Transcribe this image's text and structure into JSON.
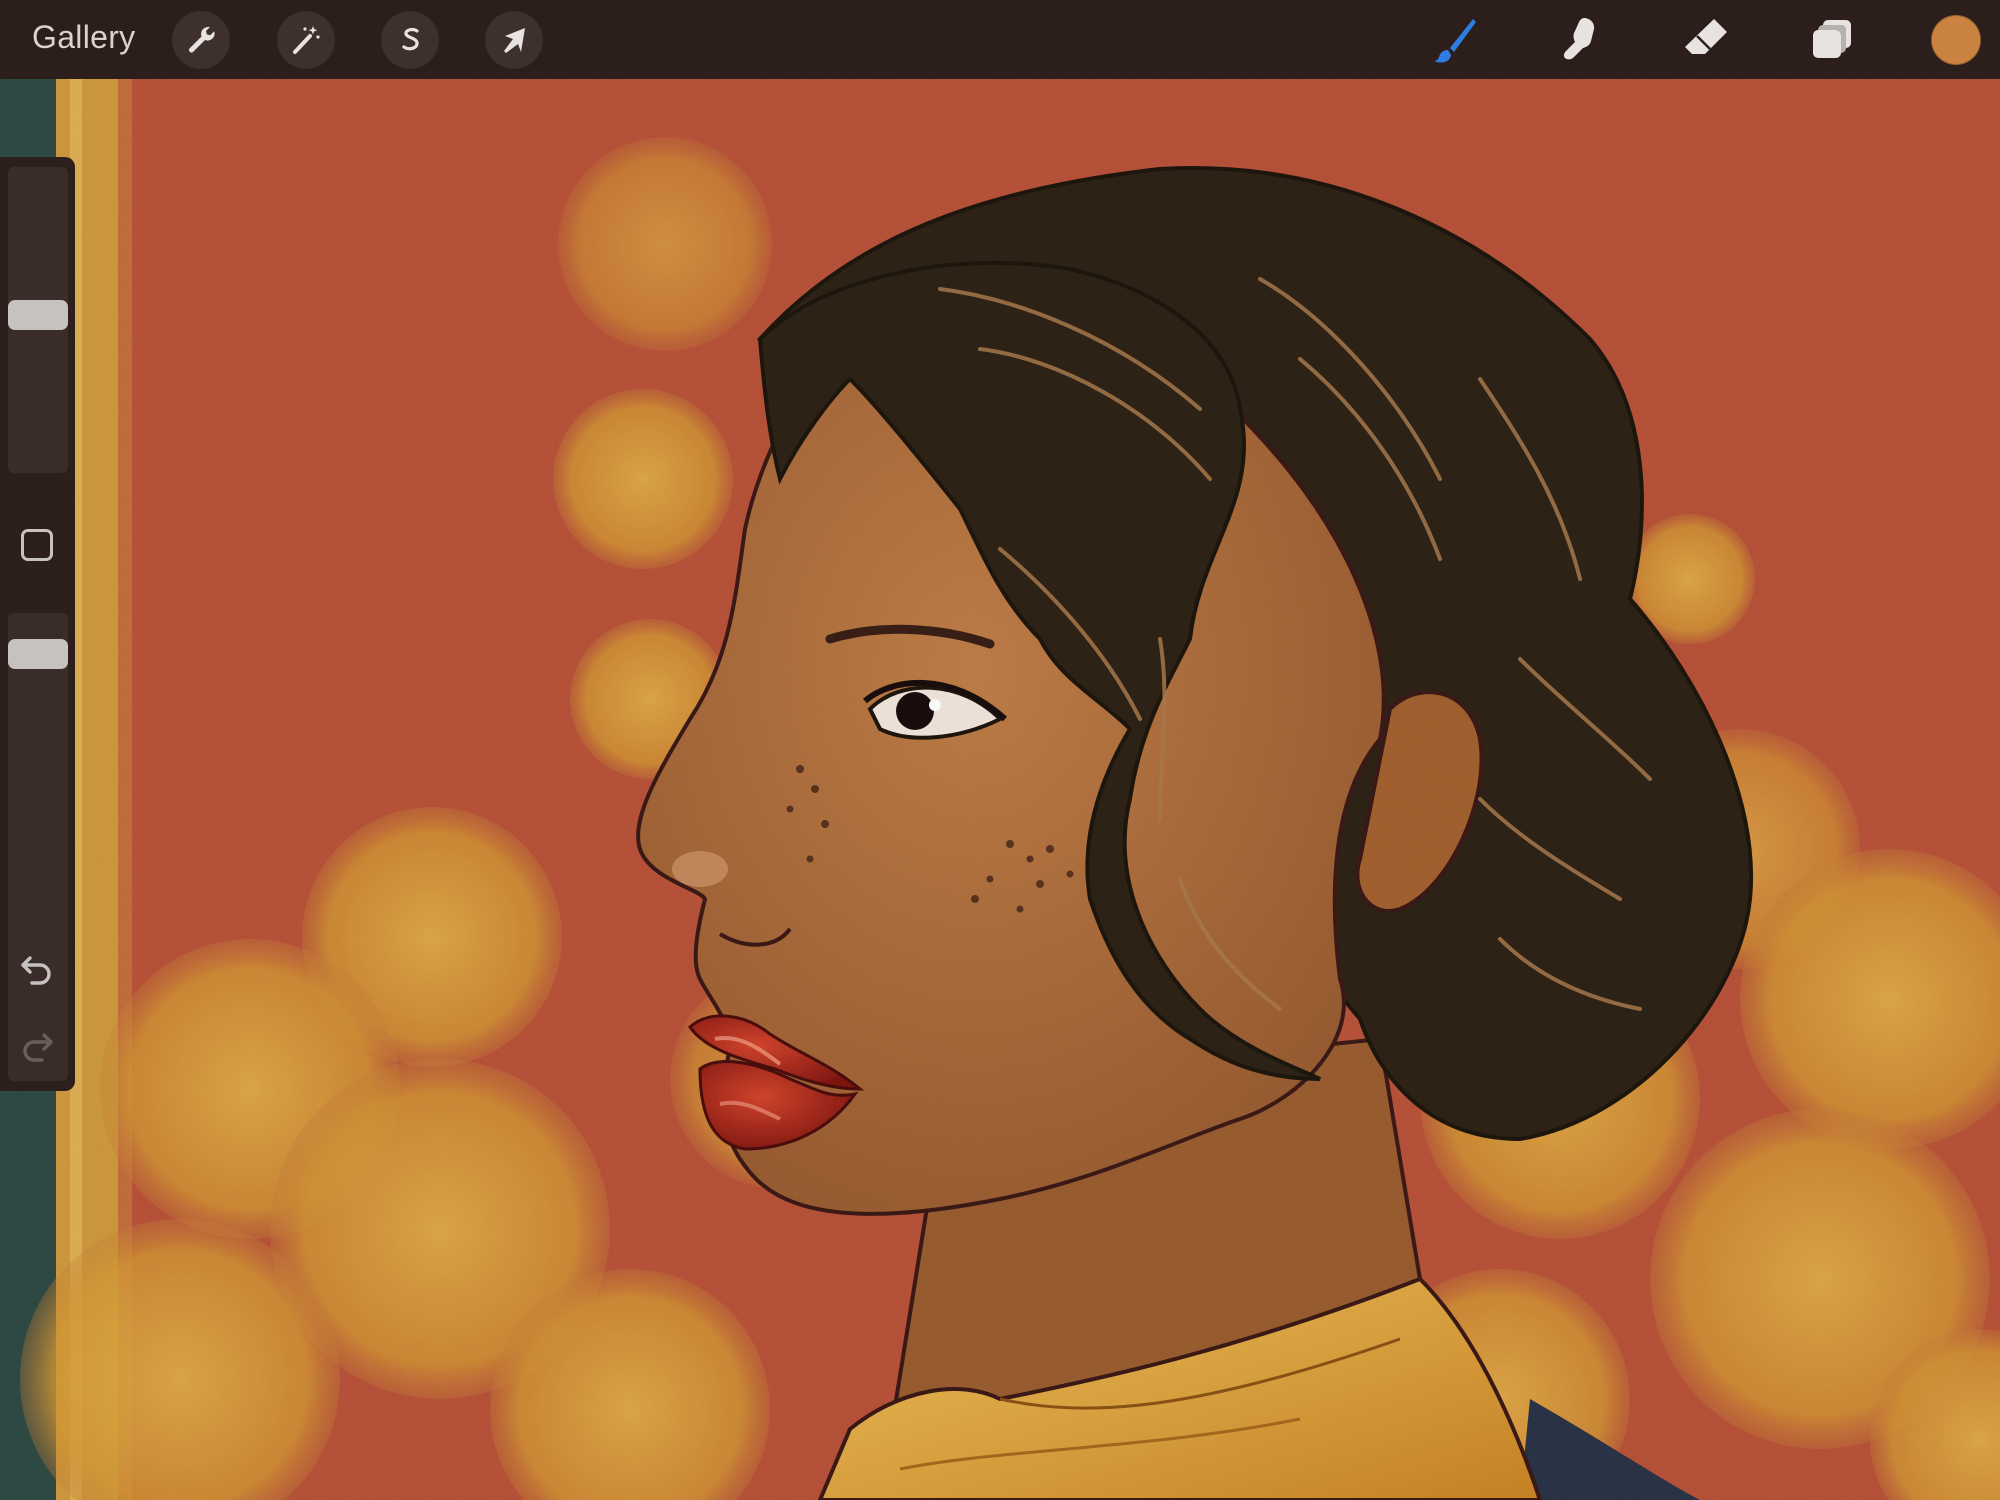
{
  "topbar": {
    "gallery_label": "Gallery",
    "left_tools": [
      {
        "name": "actions",
        "icon": "wrench-icon"
      },
      {
        "name": "adjustments",
        "icon": "magic-wand-icon"
      },
      {
        "name": "selection",
        "icon": "selection-s-icon"
      },
      {
        "name": "transform",
        "icon": "arrow-cursor-icon"
      }
    ],
    "right_tools": [
      {
        "name": "brush",
        "icon": "brush-icon",
        "active": true,
        "color": "#2f7de1"
      },
      {
        "name": "smudge",
        "icon": "smudge-finger-icon",
        "active": false
      },
      {
        "name": "eraser",
        "icon": "eraser-icon",
        "active": false
      },
      {
        "name": "layers",
        "icon": "layers-icon",
        "active": false
      }
    ],
    "current_color": "#c9823f"
  },
  "sidebar": {
    "brush_size_level": 0.52,
    "opacity_level": 0.95,
    "modify_icon": "square-modify-icon",
    "undo_icon": "undo-arrow-icon",
    "redo_icon": "redo-arrow-icon"
  },
  "canvas": {
    "artwork": "profile-portrait-illustration",
    "background_color": "#b8533a",
    "bokeh_color": "#d9a33a",
    "skin_color": "#a9683a",
    "hair_color": "#2e2419",
    "lip_color": "#a8231a",
    "scarf_color": "#d99a35",
    "jacket_color": "#2b3347"
  }
}
